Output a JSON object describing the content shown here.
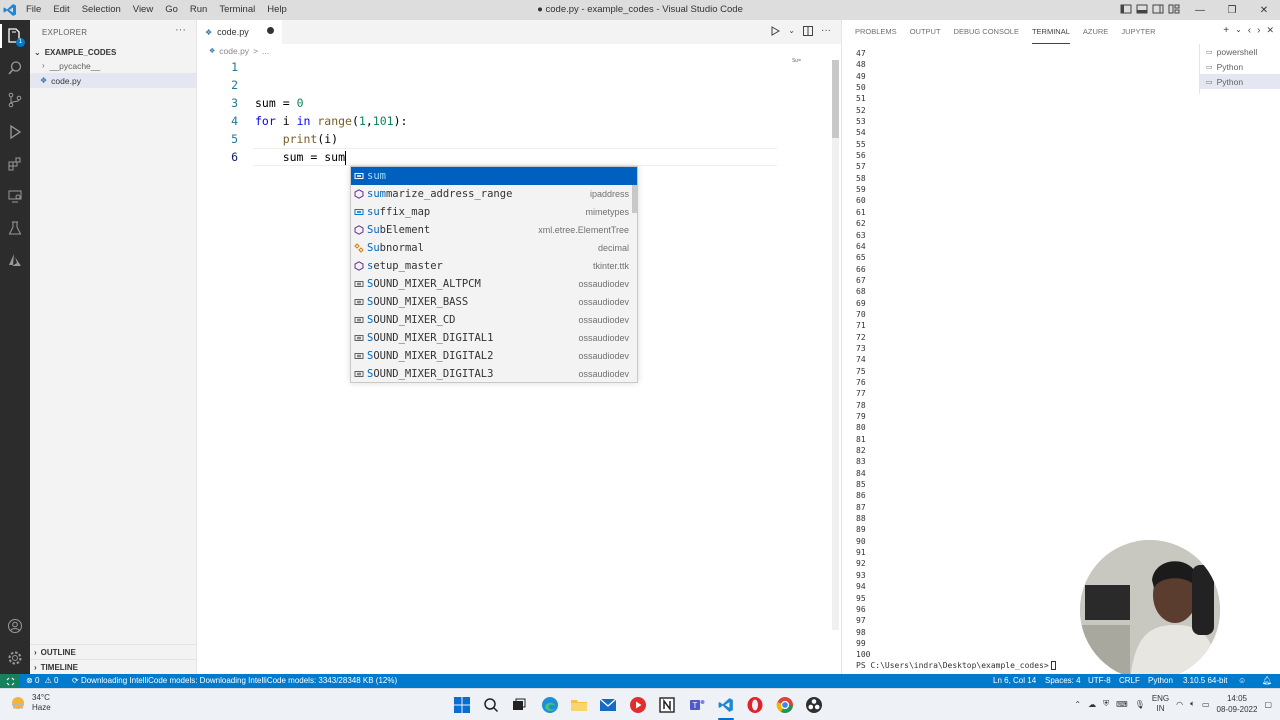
{
  "titlebar": {
    "menu": [
      "File",
      "Edit",
      "Selection",
      "View",
      "Go",
      "Run",
      "Terminal",
      "Help"
    ],
    "title": "● code.py - example_codes - Visual Studio Code"
  },
  "activity_bar": {
    "icons": [
      "explorer-icon",
      "search-icon",
      "source-control-icon",
      "run-debug-icon",
      "extensions-icon",
      "remote-explorer-icon",
      "testing-icon",
      "azure-icon"
    ],
    "explorer_badge": "1",
    "bottom_icons": [
      "account-icon",
      "manage-gear-icon"
    ]
  },
  "sidebar": {
    "title": "EXPLORER",
    "more": "···",
    "folder": "EXAMPLE_CODES",
    "items": [
      {
        "label": "__pycache__",
        "type": "folder"
      },
      {
        "label": "code.py",
        "type": "file"
      }
    ],
    "outline": "OUTLINE",
    "timeline": "TIMELINE"
  },
  "editor": {
    "tab_label": "code.py",
    "breadcrumb": [
      "code.py",
      ">",
      "..."
    ],
    "minimap_text": "Su=",
    "lines": [
      {
        "num": "1",
        "text": ""
      },
      {
        "num": "2",
        "text": ""
      },
      {
        "num": "3",
        "text": "sum = 0"
      },
      {
        "num": "4",
        "text": "for i in range(1,101):"
      },
      {
        "num": "5",
        "text": "    print(i)"
      },
      {
        "num": "6",
        "text": "    sum = sum"
      }
    ],
    "line3": {
      "var": "sum",
      "op": " = ",
      "val": "0"
    },
    "line4": {
      "kw1": "for",
      "var": " i ",
      "kw2": "in",
      "sp": " ",
      "fn": "range",
      "p1": "(",
      "a": "1",
      "c": ",",
      "b": "101",
      "p2": "):"
    },
    "line5": {
      "indent": "    ",
      "fn": "print",
      "rest": "(i)"
    },
    "line6": {
      "indent": "    ",
      "text": "sum = sum"
    }
  },
  "suggest": {
    "items": [
      {
        "label": "sum",
        "match": "sum",
        "rest": "",
        "detail": "",
        "icon": "variable-icon"
      },
      {
        "label": "summarize_address_range",
        "match": "sum",
        "rest": "marize_address_range",
        "detail": "ipaddress",
        "icon": "function-icon"
      },
      {
        "label": "suffix_map",
        "match": "su",
        "rest": "ffix_map",
        "detail": "mimetypes",
        "icon": "variable-icon"
      },
      {
        "label": "SubElement",
        "match": "Su",
        "rest": "bElement",
        "detail": "xml.etree.ElementTree",
        "icon": "function-icon"
      },
      {
        "label": "Subnormal",
        "match": "Su",
        "rest": "bnormal",
        "detail": "decimal",
        "icon": "class-icon"
      },
      {
        "label": "setup_master",
        "match": "s",
        "rest": "etup_master",
        "detail": "tkinter.ttk",
        "icon": "function-icon"
      },
      {
        "label": "SOUND_MIXER_ALTPCM",
        "match": "S",
        "rest": "OUND_MIXER_ALTPCM",
        "detail": "ossaudiodev",
        "icon": "constant-icon"
      },
      {
        "label": "SOUND_MIXER_BASS",
        "match": "S",
        "rest": "OUND_MIXER_BASS",
        "detail": "ossaudiodev",
        "icon": "constant-icon"
      },
      {
        "label": "SOUND_MIXER_CD",
        "match": "S",
        "rest": "OUND_MIXER_CD",
        "detail": "ossaudiodev",
        "icon": "constant-icon"
      },
      {
        "label": "SOUND_MIXER_DIGITAL1",
        "match": "S",
        "rest": "OUND_MIXER_DIGITAL1",
        "detail": "ossaudiodev",
        "icon": "constant-icon"
      },
      {
        "label": "SOUND_MIXER_DIGITAL2",
        "match": "S",
        "rest": "OUND_MIXER_DIGITAL2",
        "detail": "ossaudiodev",
        "icon": "constant-icon"
      },
      {
        "label": "SOUND_MIXER_DIGITAL3",
        "match": "S",
        "rest": "OUND_MIXER_DIGITAL3",
        "detail": "ossaudiodev",
        "icon": "constant-icon"
      }
    ]
  },
  "panel": {
    "tabs": [
      "PROBLEMS",
      "OUTPUT",
      "DEBUG CONSOLE",
      "TERMINAL",
      "AZURE",
      "JUPYTER"
    ],
    "active_tab": "TERMINAL",
    "terminal_lines": [
      "47",
      "48",
      "49",
      "50",
      "51",
      "52",
      "53",
      "54",
      "55",
      "56",
      "57",
      "58",
      "59",
      "60",
      "61",
      "62",
      "63",
      "64",
      "65",
      "66",
      "67",
      "68",
      "69",
      "70",
      "71",
      "72",
      "73",
      "74",
      "75",
      "76",
      "77",
      "78",
      "79",
      "80",
      "81",
      "82",
      "83",
      "84",
      "85",
      "86",
      "87",
      "88",
      "89",
      "90",
      "91",
      "92",
      "93",
      "94",
      "95",
      "96",
      "97",
      "98",
      "99",
      "100"
    ],
    "prompt": "PS C:\\Users\\indra\\Desktop\\example_codes>",
    "terminals": [
      "powershell",
      "Python",
      "Python"
    ]
  },
  "statusbar": {
    "errors": "0",
    "warnings": "0",
    "message": "Downloading IntelliCode models: Downloading IntelliCode models: 3343/28348 KB (12%)",
    "position": "Ln 6, Col 14",
    "spaces": "Spaces: 4",
    "encoding": "UTF-8",
    "eol": "CRLF",
    "language": "Python",
    "interpreter": "3.10.5 64-bit"
  },
  "taskbar": {
    "weather_temp": "34°C",
    "weather_desc": "Haze",
    "lang_top": "ENG",
    "lang_bottom": "IN",
    "time": "14:05",
    "date": "08-09-2022"
  },
  "colors": {
    "accent": "#007acc",
    "keyword": "#0000ff",
    "number": "#098658",
    "function": "#795e26",
    "suggest_selected": "#0060c0"
  }
}
